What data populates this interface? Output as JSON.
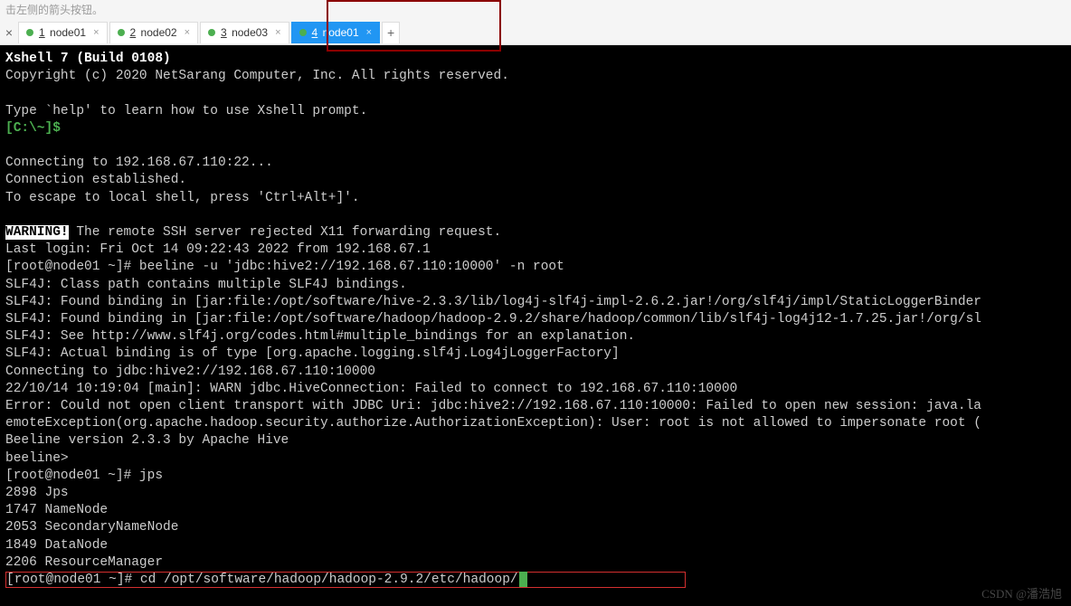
{
  "hint": "击左侧的箭头按钮。",
  "tabs": [
    {
      "num": "1",
      "label": "node01"
    },
    {
      "num": "2",
      "label": "node02"
    },
    {
      "num": "3",
      "label": "node03"
    },
    {
      "num": "4",
      "label": "node01"
    }
  ],
  "add": "+",
  "close_all": "×",
  "tab_close": "×",
  "term": {
    "l0": "Xshell 7 (Build 0108)",
    "l1": "Copyright (c) 2020 NetSarang Computer, Inc. All rights reserved.",
    "l2": "",
    "l3": "Type `help' to learn how to use Xshell prompt.",
    "l4": "[C:\\~]$ ",
    "l5": "",
    "l6": "Connecting to 192.168.67.110:22...",
    "l7": "Connection established.",
    "l8": "To escape to local shell, press 'Ctrl+Alt+]'.",
    "l9": "",
    "warn": "WARNING!",
    "l10b": " The remote SSH server rejected X11 forwarding request.",
    "l11": "Last login: Fri Oct 14 09:22:43 2022 from 192.168.67.1",
    "l12": "[root@node01 ~]# beeline -u 'jdbc:hive2://192.168.67.110:10000' -n root",
    "l13": "SLF4J: Class path contains multiple SLF4J bindings.",
    "l14": "SLF4J: Found binding in [jar:file:/opt/software/hive-2.3.3/lib/log4j-slf4j-impl-2.6.2.jar!/org/slf4j/impl/StaticLoggerBinder",
    "l15": "SLF4J: Found binding in [jar:file:/opt/software/hadoop/hadoop-2.9.2/share/hadoop/common/lib/slf4j-log4j12-1.7.25.jar!/org/sl",
    "l16": "SLF4J: See http://www.slf4j.org/codes.html#multiple_bindings for an explanation.",
    "l17": "SLF4J: Actual binding is of type [org.apache.logging.slf4j.Log4jLoggerFactory]",
    "l18": "Connecting to jdbc:hive2://192.168.67.110:10000",
    "l19": "22/10/14 10:19:04 [main]: WARN jdbc.HiveConnection: Failed to connect to 192.168.67.110:10000",
    "l20": "Error: Could not open client transport with JDBC Uri: jdbc:hive2://192.168.67.110:10000: Failed to open new session: java.la",
    "l21": "emoteException(org.apache.hadoop.security.authorize.AuthorizationException): User: root is not allowed to impersonate root (",
    "l22": "Beeline version 2.3.3 by Apache Hive",
    "l23": "beeline> ",
    "l24": "[root@node01 ~]# jps",
    "l25": "2898 Jps",
    "l26": "1747 NameNode",
    "l27": "2053 SecondaryNameNode",
    "l28": "1849 DataNode",
    "l29": "2206 ResourceManager",
    "l30a": "[root@node01 ~]# cd /opt/software/hadoop/hadoop-2.9.2/etc/hadoop/"
  },
  "watermark": "CSDN @潘浩旭"
}
